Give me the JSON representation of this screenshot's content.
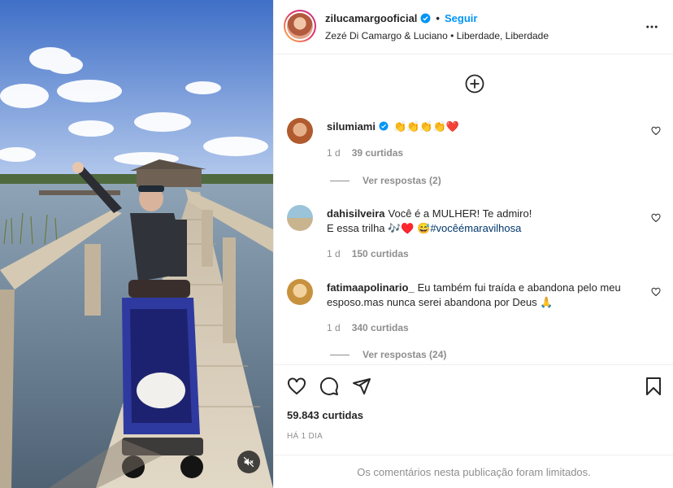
{
  "post": {
    "username": "zilucamargooficial",
    "follow_label": "Seguir",
    "location_line": "Zezé Di Camargo & Luciano • Liberdade, Liberdade",
    "likes_total": "59.843 curtidas",
    "time_ago": "HÁ 1 DIA",
    "comments_limited_notice": "Os comentários nesta publicação foram limitados."
  },
  "comments": [
    {
      "username": "silumiami",
      "verified": true,
      "text": "👏👏👏👏❤️",
      "age": "1 d",
      "likes": "39 curtidas",
      "replies_label": "Ver respostas (2)"
    },
    {
      "username": "dahisilveira",
      "text_line1": "Você é a MULHER! Te admiro!",
      "text_line2_prefix": "E essa trilha 🎶♥️ 😅",
      "hashtag": "#vocêémaravilhosa",
      "age": "1 d",
      "likes": "150 curtidas"
    },
    {
      "username": "fatimaapolinario_",
      "text": "Eu também fui traída e abandona pelo meu esposo.mas nunca serei abandona por Deus 🙏",
      "age": "1 d",
      "likes": "340 curtidas",
      "replies_label": "Ver respostas (24)"
    }
  ],
  "icons": {
    "verified": "verified-badge-icon",
    "more": "more-options-icon",
    "add": "add-circle-icon",
    "heart": "heart-icon",
    "comment": "comment-icon",
    "share": "share-icon",
    "save": "bookmark-icon",
    "mute": "muted-speaker-icon"
  },
  "colors": {
    "accent": "#0095f6",
    "text": "#262626",
    "muted": "#8e8e8e",
    "border": "#efefef"
  }
}
